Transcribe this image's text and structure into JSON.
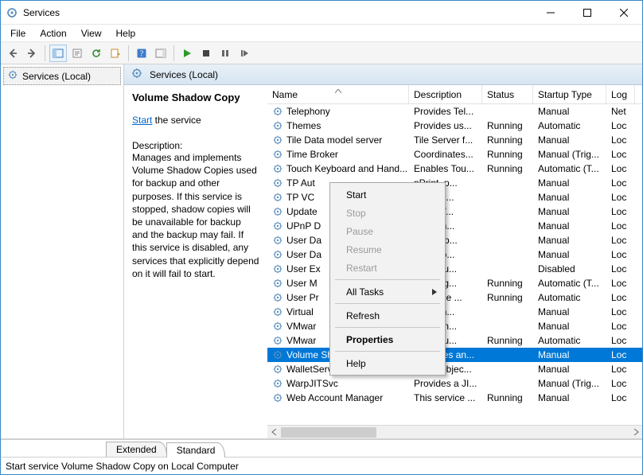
{
  "title": "Services",
  "menus": {
    "file": "File",
    "action": "Action",
    "view": "View",
    "help": "Help"
  },
  "tree_root": "Services (Local)",
  "pane_title": "Services (Local)",
  "detail": {
    "heading": "Volume Shadow Copy",
    "start_link": "Start",
    "start_suffix": " the service",
    "desc_label": "Description:",
    "desc_body": "Manages and implements Volume Shadow Copies used for backup and other purposes. If this service is stopped, shadow copies will be unavailable for backup and the backup may fail. If this service is disabled, any services that explicitly depend on it will fail to start."
  },
  "columns": {
    "name": "Name",
    "desc": "Description",
    "status": "Status",
    "start": "Startup Type",
    "log": "Log"
  },
  "rows": [
    {
      "name": "Telephony",
      "desc": "Provides Tel...",
      "status": "",
      "start": "Manual",
      "log": "Net"
    },
    {
      "name": "Themes",
      "desc": "Provides us...",
      "status": "Running",
      "start": "Automatic",
      "log": "Loc"
    },
    {
      "name": "Tile Data model server",
      "desc": "Tile Server f...",
      "status": "Running",
      "start": "Manual",
      "log": "Loc"
    },
    {
      "name": "Time Broker",
      "desc": "Coordinates...",
      "status": "Running",
      "start": "Manual (Trig...",
      "log": "Loc"
    },
    {
      "name": "Touch Keyboard and Hand...",
      "desc": "Enables Tou...",
      "status": "Running",
      "start": "Automatic (T...",
      "log": "Loc"
    },
    {
      "name": "TP Aut",
      "desc": "nPrint .p...",
      "status": "",
      "start": "Manual",
      "log": "Loc"
    },
    {
      "name": "TP VC",
      "desc": "nPrint c...",
      "status": "",
      "start": "Manual",
      "log": "Loc"
    },
    {
      "name": "Update",
      "desc": "ages W...",
      "status": "",
      "start": "Manual",
      "log": "Loc"
    },
    {
      "name": "UPnP D",
      "desc": "ws UPn...",
      "status": "",
      "start": "Manual",
      "log": "Loc"
    },
    {
      "name": "User Da",
      "desc": "vides ap...",
      "status": "",
      "start": "Manual",
      "log": "Loc"
    },
    {
      "name": "User Da",
      "desc": "dles sto...",
      "status": "",
      "start": "Manual",
      "log": "Loc"
    },
    {
      "name": "User Ex",
      "desc": "vides su...",
      "status": "",
      "start": "Disabled",
      "log": "Loc"
    },
    {
      "name": "User M",
      "desc": "r Manag...",
      "status": "Running",
      "start": "Automatic (T...",
      "log": "Loc"
    },
    {
      "name": "User Pr",
      "desc": "s service ...",
      "status": "Running",
      "start": "Automatic",
      "log": "Loc"
    },
    {
      "name": "Virtual",
      "desc": "vides m...",
      "status": "",
      "start": "Manual",
      "log": "Loc"
    },
    {
      "name": "VMwar",
      "desc": "ware Sn...",
      "status": "",
      "start": "Manual",
      "log": "Loc"
    },
    {
      "name": "VMwar",
      "desc": "vides su...",
      "status": "Running",
      "start": "Automatic",
      "log": "Loc"
    },
    {
      "name": "Volume Shadow Copy",
      "desc": "Manages an...",
      "status": "",
      "start": "Manual",
      "log": "Loc",
      "selected": true
    },
    {
      "name": "WalletService",
      "desc": "Hosts objec...",
      "status": "",
      "start": "Manual",
      "log": "Loc"
    },
    {
      "name": "WarpJITSvc",
      "desc": "Provides a JI...",
      "status": "",
      "start": "Manual (Trig...",
      "log": "Loc"
    },
    {
      "name": "Web Account Manager",
      "desc": "This service ...",
      "status": "Running",
      "start": "Manual",
      "log": "Loc"
    }
  ],
  "context": {
    "start": "Start",
    "stop": "Stop",
    "pause": "Pause",
    "resume": "Resume",
    "restart": "Restart",
    "alltasks": "All Tasks",
    "refresh": "Refresh",
    "properties": "Properties",
    "help": "Help"
  },
  "tabs": {
    "extended": "Extended",
    "standard": "Standard"
  },
  "statusbar": "Start service Volume Shadow Copy on Local Computer"
}
